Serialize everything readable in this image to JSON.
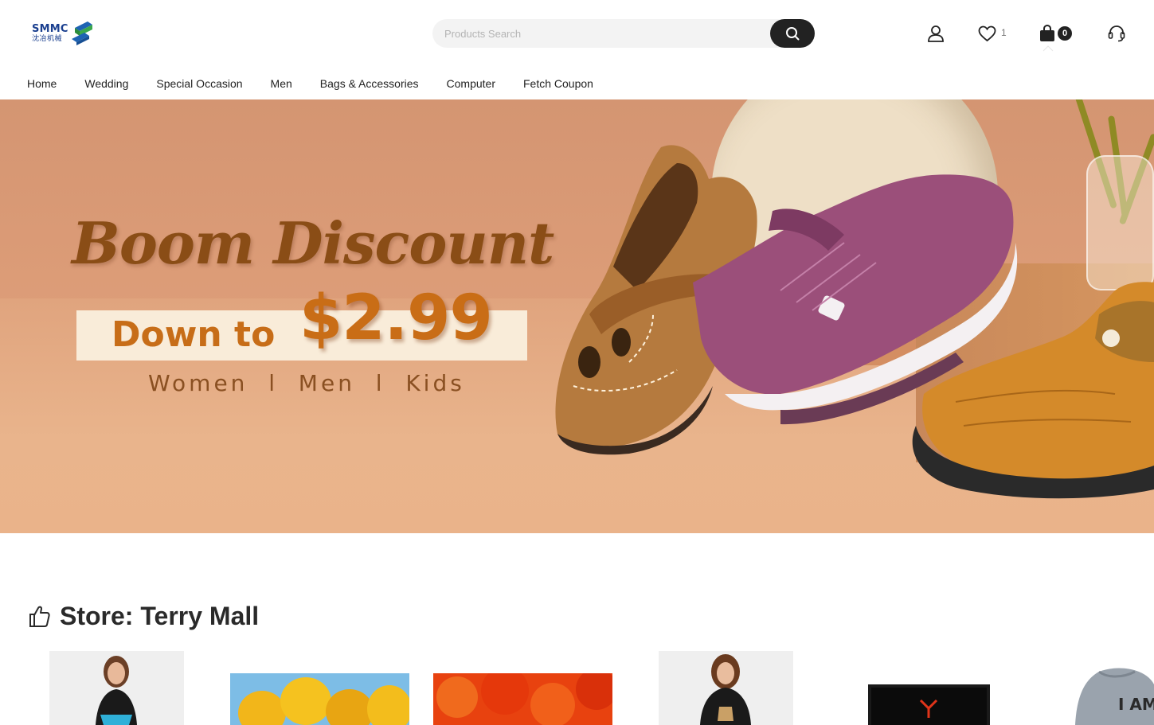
{
  "brand": {
    "name": "SMMC",
    "subname": "沈冶机械"
  },
  "search": {
    "placeholder": "Products Search"
  },
  "header": {
    "wishlist_count": "1",
    "cart_count": "0"
  },
  "nav": {
    "items": [
      {
        "label": "Home"
      },
      {
        "label": "Wedding"
      },
      {
        "label": "Special Occasion"
      },
      {
        "label": "Men"
      },
      {
        "label": "Bags & Accessories"
      },
      {
        "label": "Computer"
      },
      {
        "label": "Fetch Coupon"
      }
    ]
  },
  "banner": {
    "headline": "Boom Discount",
    "prefix": "Down to",
    "price": "$2.99",
    "categories": "Women  l  Men  l  Kids"
  },
  "store": {
    "title": "Store: Terry Mall"
  },
  "colors": {
    "accent": "#222222",
    "banner_text": "#c96d16",
    "banner_brown": "#8a4d16"
  }
}
